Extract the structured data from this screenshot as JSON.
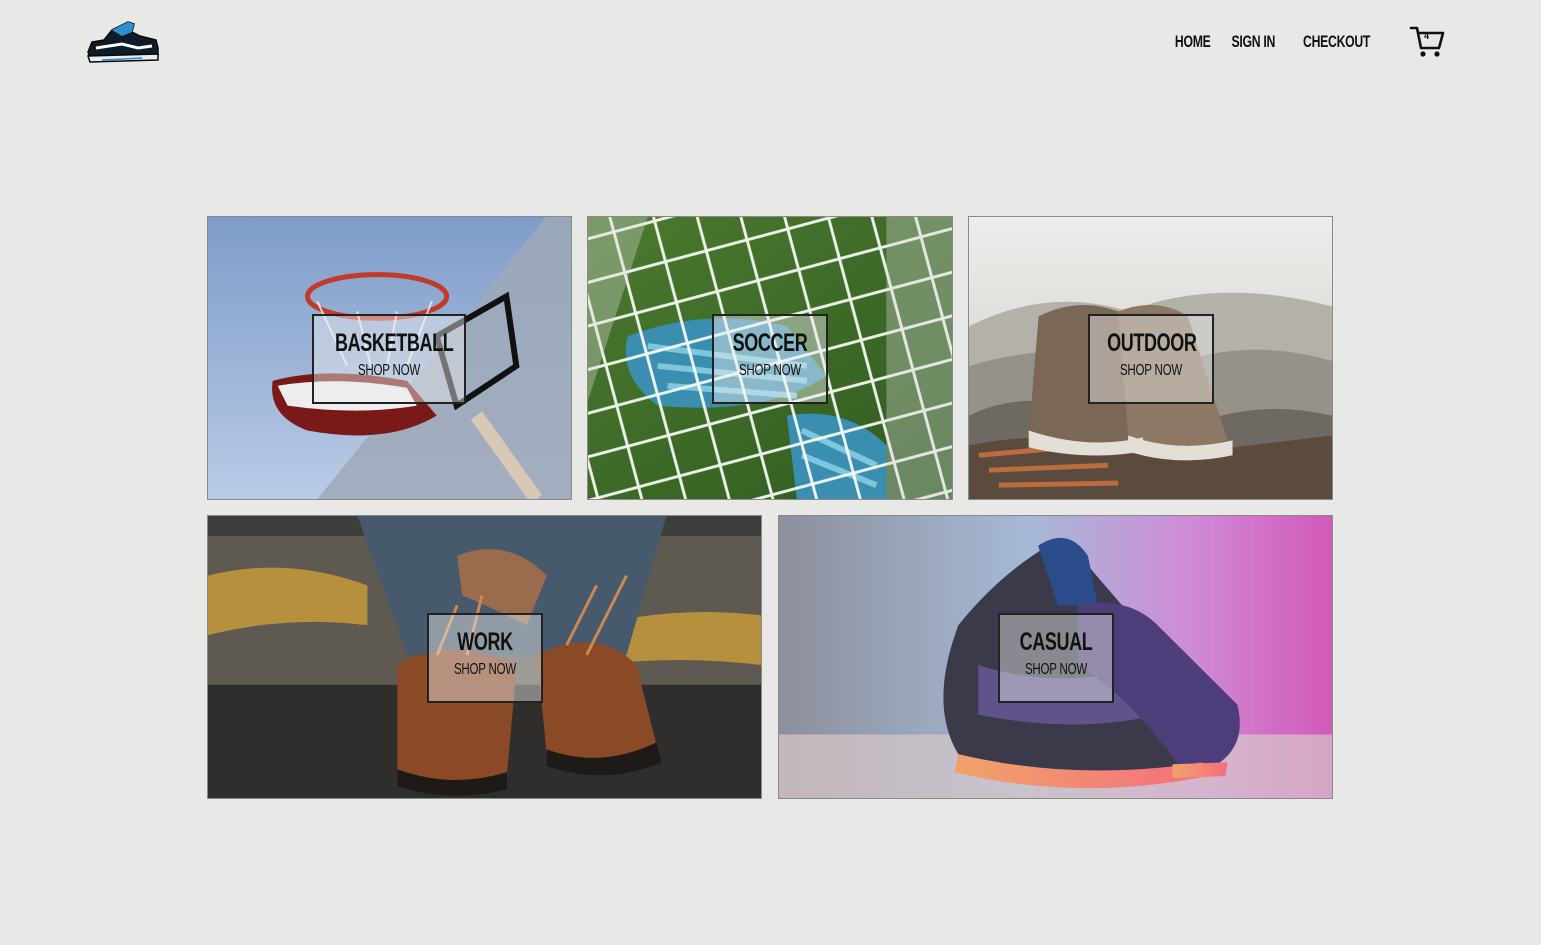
{
  "header": {
    "logo_icon": "sneaker-logo-icon",
    "nav": [
      {
        "label": "HOME"
      },
      {
        "label": "SIGN IN"
      },
      {
        "label": "CHECKOUT"
      }
    ],
    "cart": {
      "icon": "shopping-cart-icon",
      "count": "4"
    }
  },
  "categories": [
    {
      "title": "BASKETBALL",
      "cta": "SHOP NOW"
    },
    {
      "title": "SOCCER",
      "cta": "SHOP NOW"
    },
    {
      "title": "OUTDOOR",
      "cta": "SHOP NOW"
    },
    {
      "title": "WORK",
      "cta": "SHOP NOW"
    },
    {
      "title": "CASUAL",
      "cta": "SHOP NOW"
    }
  ],
  "colors": {
    "background": "#e8e8e6",
    "text": "#111111",
    "label_border": "#222222"
  }
}
